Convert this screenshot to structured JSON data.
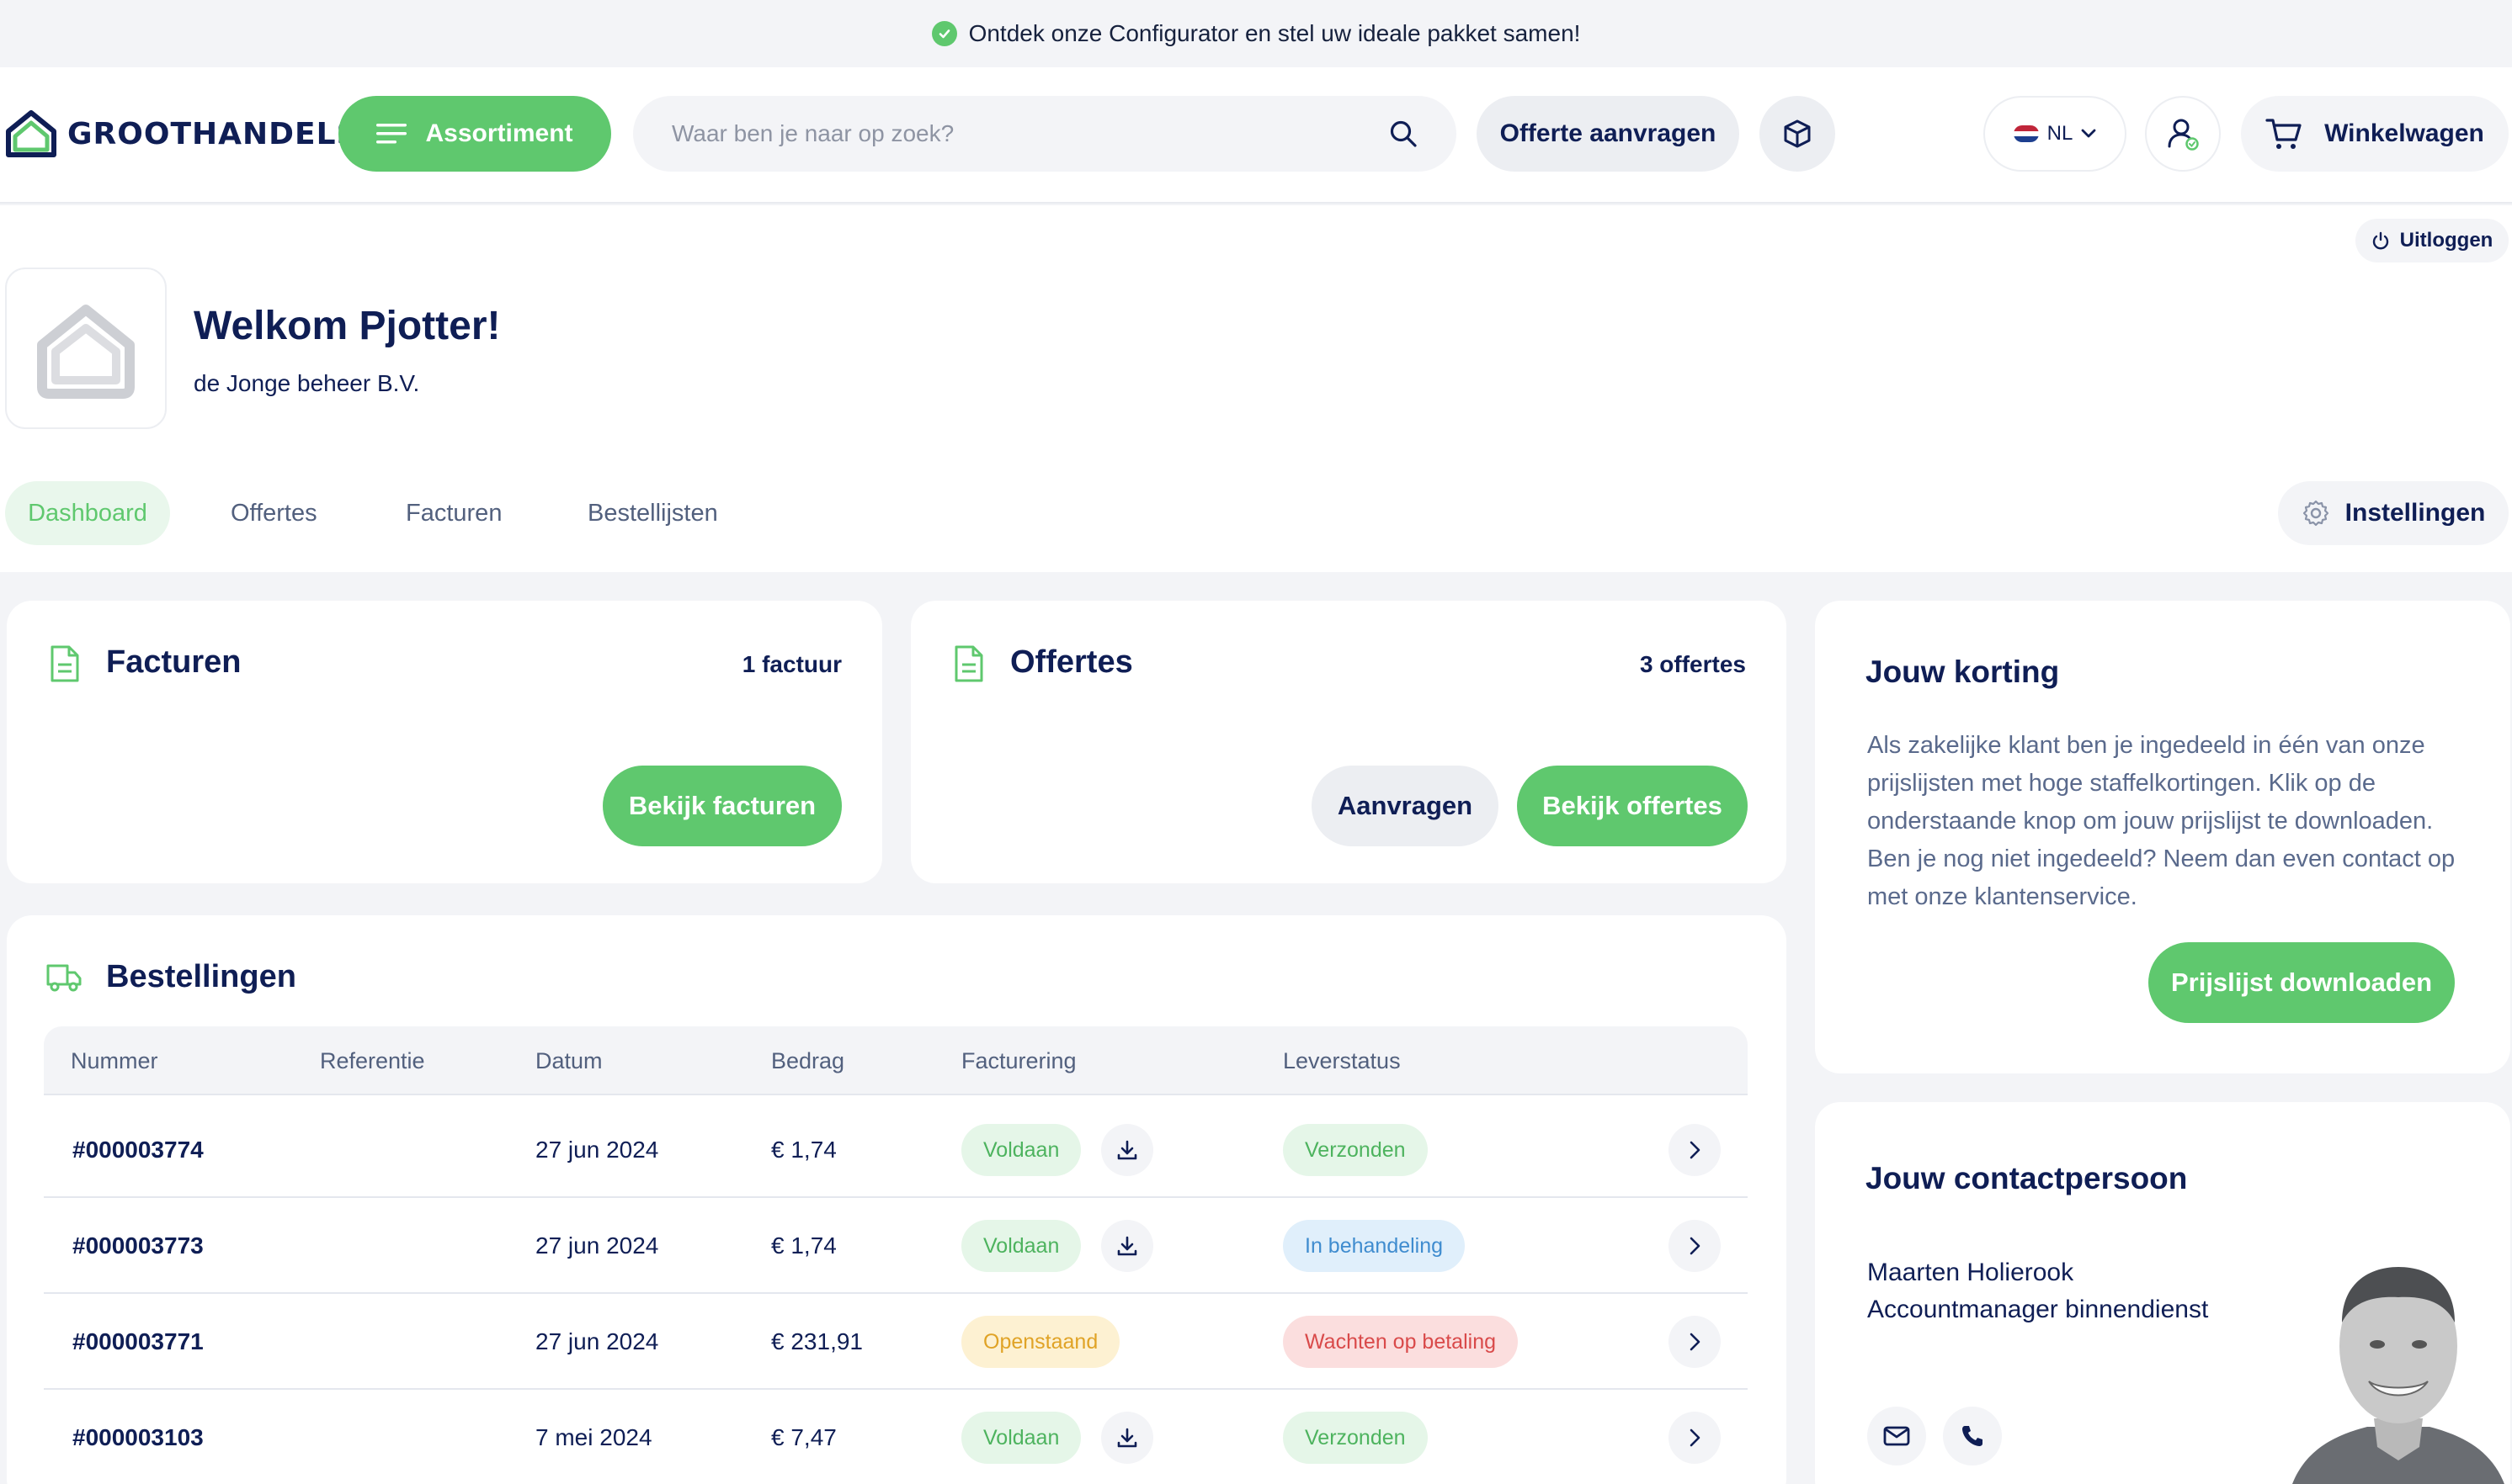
{
  "banner": {
    "text": "Ontdek onze Configurator en stel uw ideale pakket samen!"
  },
  "header": {
    "logo_text": "GROOTHANDELSOLAR",
    "assortiment_label": "Assortiment",
    "search_placeholder": "Waar ben je naar op zoek?",
    "offerte_label": "Offerte aanvragen",
    "language": "NL",
    "cart_label": "Winkelwagen"
  },
  "profile": {
    "logout_label": "Uitloggen",
    "welcome": "Welkom Pjotter!",
    "company": "de Jonge beheer B.V.",
    "tabs": [
      "Dashboard",
      "Offertes",
      "Facturen",
      "Bestellijsten"
    ],
    "settings_label": "Instellingen"
  },
  "facturen_card": {
    "title": "Facturen",
    "count": "1 factuur",
    "button": "Bekijk facturen"
  },
  "offertes_card": {
    "title": "Offertes",
    "count": "3 offertes",
    "request_button": "Aanvragen",
    "view_button": "Bekijk offertes"
  },
  "orders": {
    "title": "Bestellingen",
    "columns": [
      "Nummer",
      "Referentie",
      "Datum",
      "Bedrag",
      "Facturering",
      "Leverstatus"
    ],
    "rows": [
      {
        "number": "#000003774",
        "reference": "",
        "date": "27 jun 2024",
        "amount": "€ 1,74",
        "billing": "Voldaan",
        "billing_color": "green",
        "delivery": "Verzonden",
        "delivery_color": "green"
      },
      {
        "number": "#000003773",
        "reference": "",
        "date": "27 jun 2024",
        "amount": "€ 1,74",
        "billing": "Voldaan",
        "billing_color": "green",
        "delivery": "In behandeling",
        "delivery_color": "blue"
      },
      {
        "number": "#000003771",
        "reference": "",
        "date": "27 jun 2024",
        "amount": "€ 231,91",
        "billing": "Openstaand",
        "billing_color": "yellow",
        "delivery": "Wachten op betaling",
        "delivery_color": "red"
      },
      {
        "number": "#000003103",
        "reference": "",
        "date": "7 mei 2024",
        "amount": "€ 7,47",
        "billing": "Voldaan",
        "billing_color": "green",
        "delivery": "Verzonden",
        "delivery_color": "green"
      }
    ]
  },
  "discount": {
    "title": "Jouw korting",
    "text": "Als zakelijke klant ben je ingedeeld in één van onze prijslijsten met hoge staffelkortingen. Klik op de onderstaande knop om jouw prijslijst te downloaden. Ben je nog niet ingedeeld? Neem dan even contact op met onze klantenservice.",
    "button": "Prijslijst downloaden"
  },
  "contact": {
    "title": "Jouw contactpersoon",
    "name": "Maarten Holierook",
    "role": "Accountmanager binnendienst"
  },
  "colors": {
    "accent": "#5fc86e",
    "navy": "#0f1e55",
    "background": "#f3f4f7"
  }
}
